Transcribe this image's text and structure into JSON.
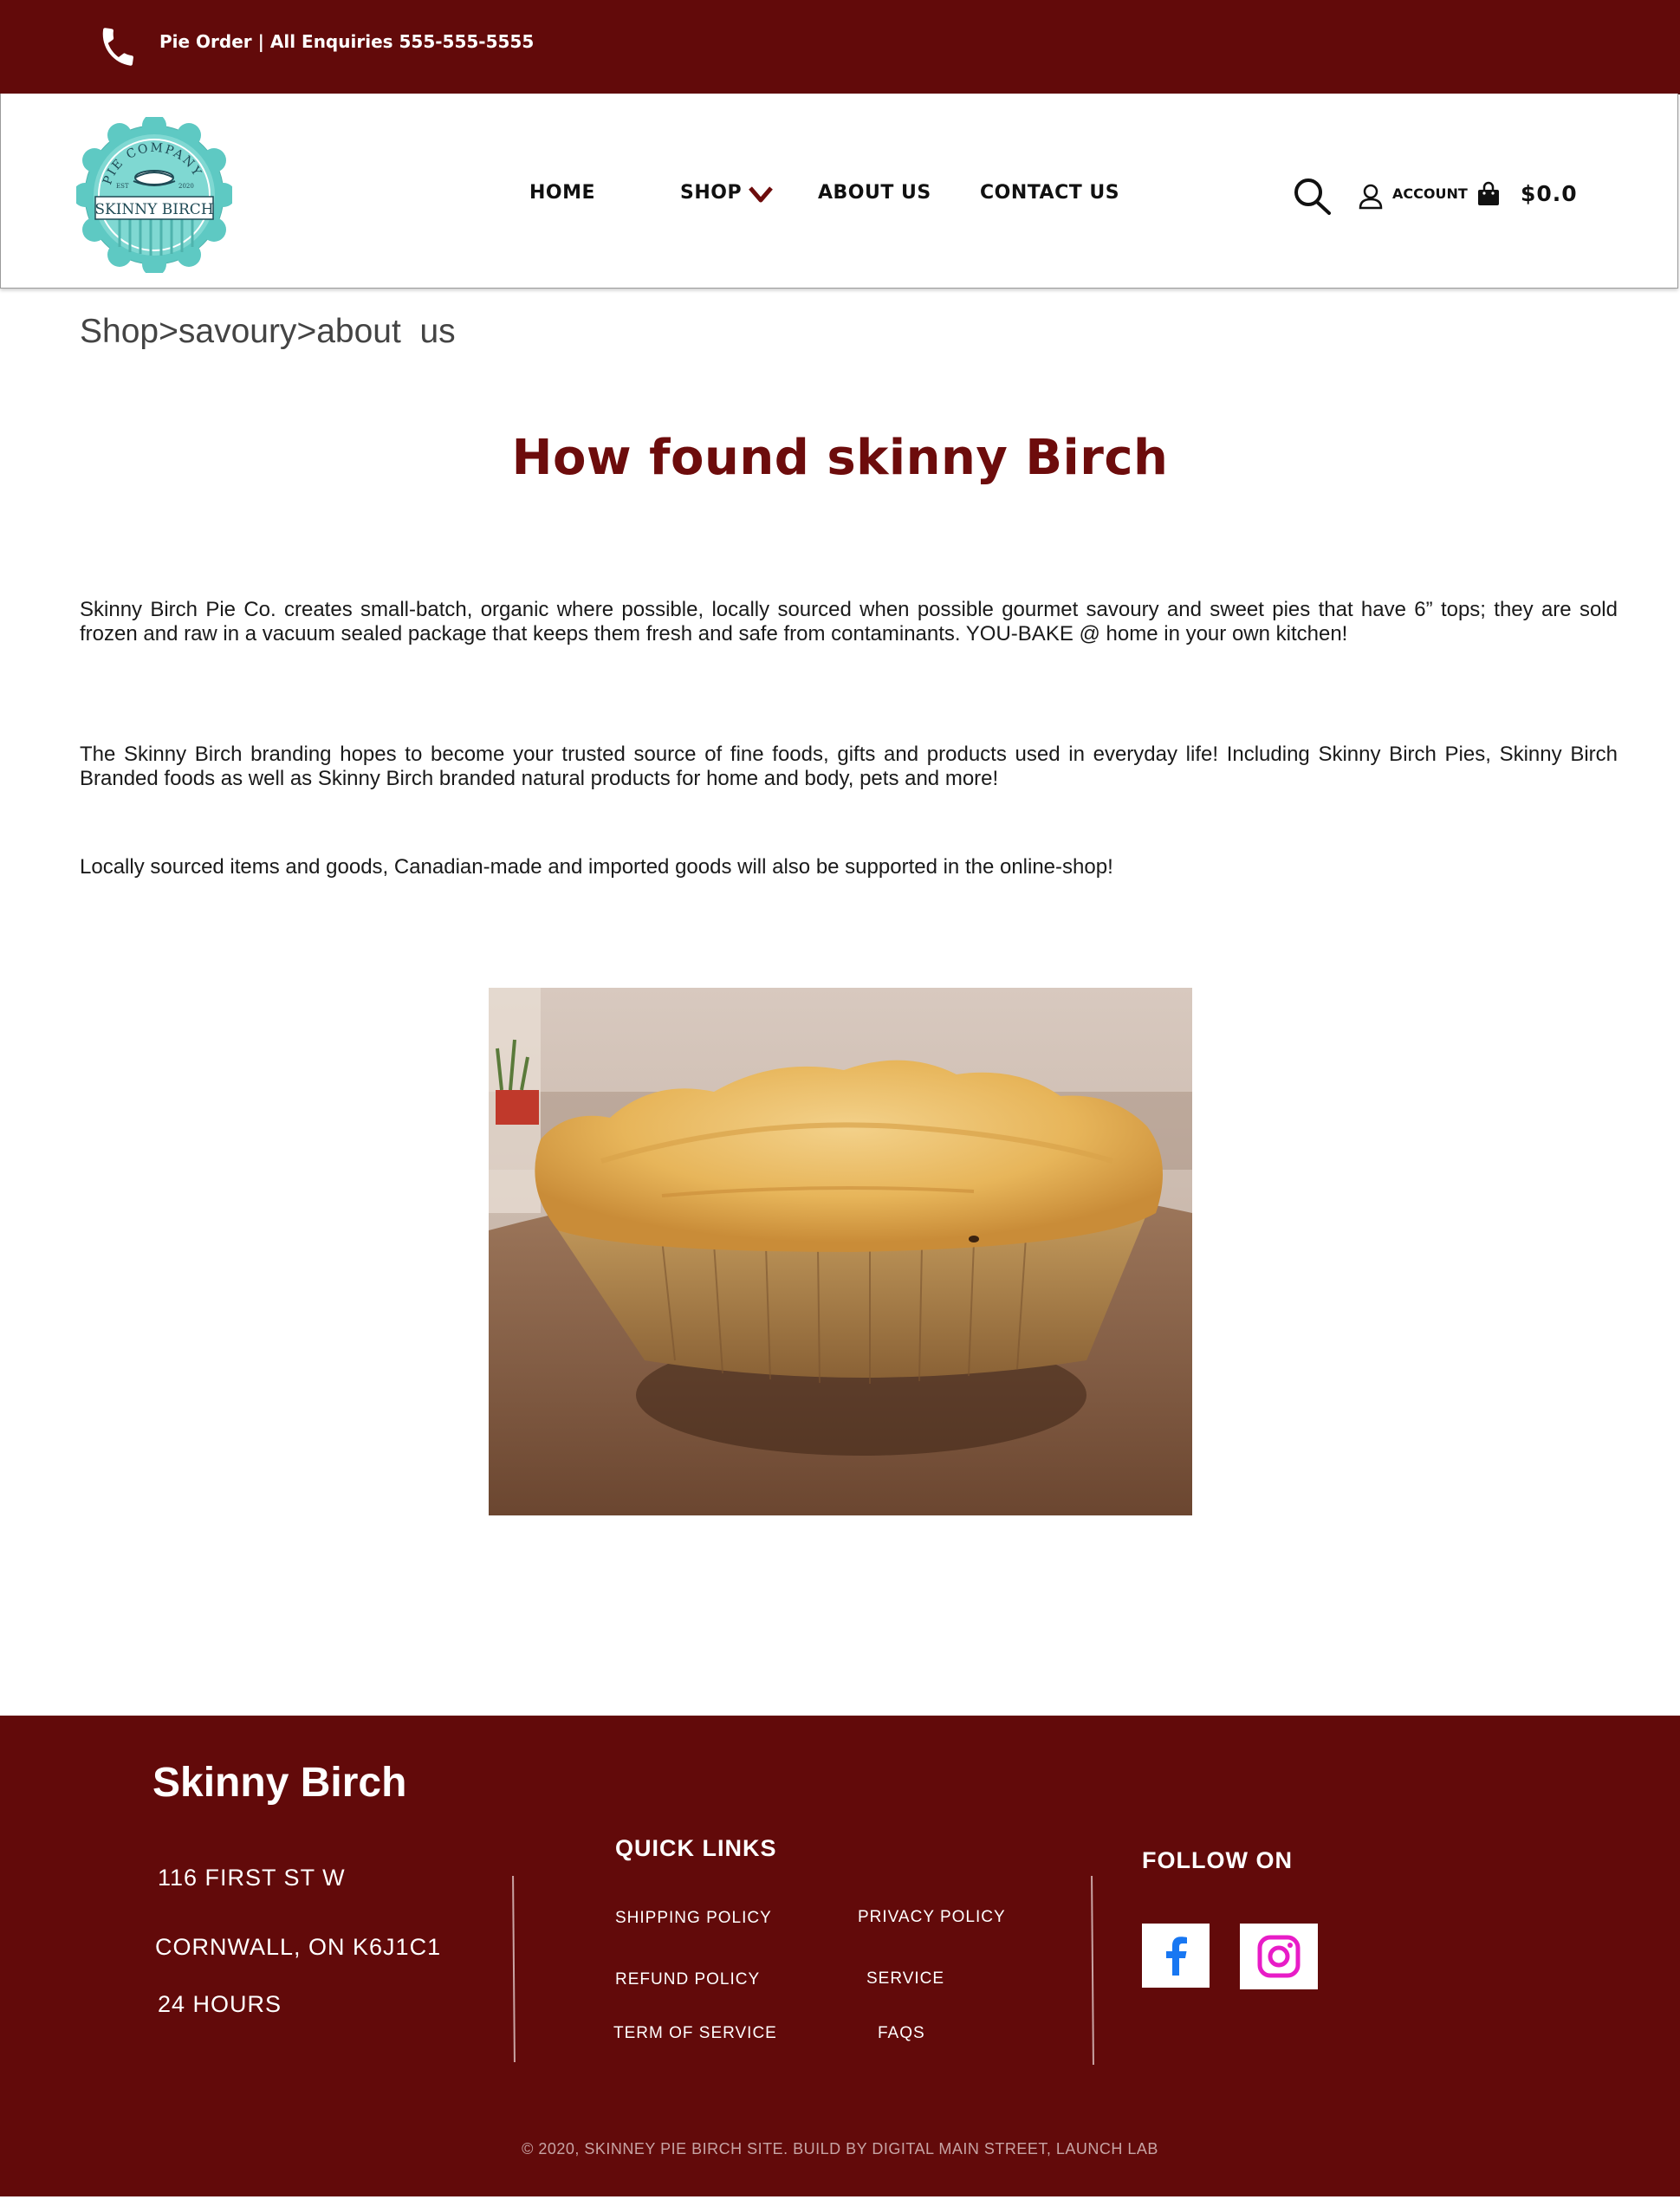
{
  "topbar": {
    "contact_text": "Pie Order | All Enquiries  555-555-5555",
    "icon": "phone-icon"
  },
  "logo": {
    "arc_text": "PIE COMPANY",
    "est": "EST",
    "year": "2020",
    "name": "SKINNY BIRCH",
    "colors": {
      "teal": "#5ec9c3",
      "dark": "#1f4a55"
    }
  },
  "nav": {
    "items": [
      {
        "label": "HOME"
      },
      {
        "label": "SHOP"
      },
      {
        "label": "ABOUT US"
      },
      {
        "label": "CONTACT US"
      }
    ],
    "account_label": "ACCOUNT",
    "cart_total": "$0.0"
  },
  "breadcrumb": {
    "items": [
      "Shop",
      ">",
      "savoury",
      ">",
      "about  us"
    ]
  },
  "page": {
    "title": "How found skinny Birch",
    "paragraphs": [
      "Skinny Birch Pie Co. creates small-batch, organic where possible, locally sourced when possible gourmet savoury and sweet pies that have 6” tops; they are sold frozen and raw in a vacuum sealed package that keeps them fresh and safe from contaminants. YOU-BAKE @ home in your own kitchen!",
      "The Skinny Birch branding hopes to become your trusted source of fine foods, gifts and products used in everyday life! Including Skinny Birch Pies, Skinny Birch Branded foods as well as Skinny Birch branded natural products for home and body, pets and more!",
      "Locally sourced items and goods, Canadian-made and imported goods will also be supported in the online-shop!"
    ]
  },
  "footer": {
    "brand": "Skinny Birch",
    "address_line1": "116 FIRST ST W",
    "address_line2": "CORNWALL, ON K6J1C1",
    "hours": "24 HOURS",
    "quick_links_title": "QUICK LINKS",
    "links": {
      "shipping": "SHIPPING POLICY",
      "privacy": "PRIVACY POLICY",
      "refund": "REFUND POLICY",
      "service": "SERVICE",
      "terms": "TERM OF SERVICE",
      "faqs": "FAQS"
    },
    "follow_title": "FOLLOW ON",
    "social": [
      "facebook-icon",
      "instagram-icon"
    ],
    "copyright": "© 2020, SKINNEY PIE BIRCH SITE. BUILD BY DIGITAL MAIN STREET, LAUNCH LAB"
  },
  "colors": {
    "brand_maroon": "#620a0a",
    "title_maroon": "#6d0c0c",
    "facebook_blue": "#1877f2",
    "instagram_magenta": "#e81cc7"
  }
}
